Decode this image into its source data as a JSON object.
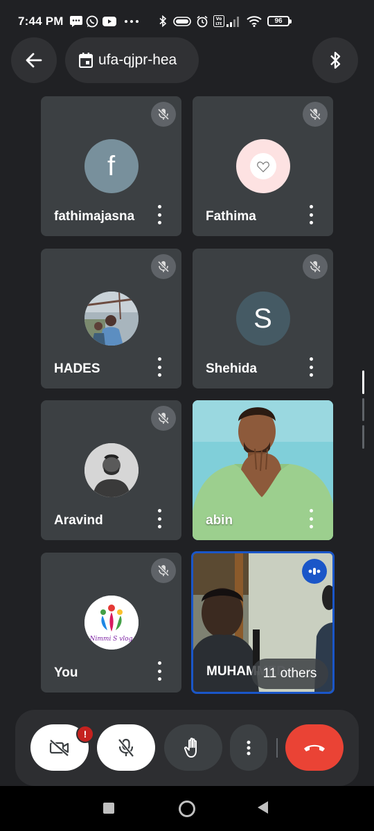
{
  "status_bar": {
    "time": "7:44 PM",
    "battery": "96",
    "icons": [
      "messages-icon",
      "whatsapp-icon",
      "youtube-icon",
      "more-notifications-icon",
      "bluetooth-icon",
      "toggle-icon",
      "alarm-icon",
      "volte-icon",
      "signal-icon",
      "wifi-icon",
      "battery-icon"
    ]
  },
  "top_bar": {
    "meeting_code": "ufa-qjpr-hea"
  },
  "participants": [
    {
      "name": "fathimajasna",
      "avatar_letter": "f",
      "avatar_color": "#78909c",
      "muted": true
    },
    {
      "name": "Fathima",
      "avatar_type": "heart",
      "avatar_color": "#fde2e2",
      "muted": true
    },
    {
      "name": "HADES",
      "avatar_type": "photo",
      "muted": true
    },
    {
      "name": "Shehida",
      "avatar_letter": "S",
      "avatar_color": "#455a64",
      "muted": true
    },
    {
      "name": "Aravind",
      "avatar_type": "photo",
      "muted": true
    },
    {
      "name": "abin",
      "avatar_type": "video",
      "muted": false
    },
    {
      "name": "You",
      "avatar_type": "logo",
      "logo_text": "Nimmi S vlog",
      "muted": true
    },
    {
      "name": "MUHAMMED",
      "avatar_type": "video",
      "speaking": true,
      "others_label": "11 others"
    }
  ],
  "controls": {
    "camera": "camera-off",
    "mic": "mic-off",
    "raise_hand": "raise-hand",
    "more": "more-options",
    "end_call": "end-call"
  },
  "colors": {
    "background": "#202124",
    "tile": "#3c4043",
    "end_call": "#ea4335",
    "active_speaker_border": "#1a73e8",
    "alert_badge": "#c5221f"
  }
}
